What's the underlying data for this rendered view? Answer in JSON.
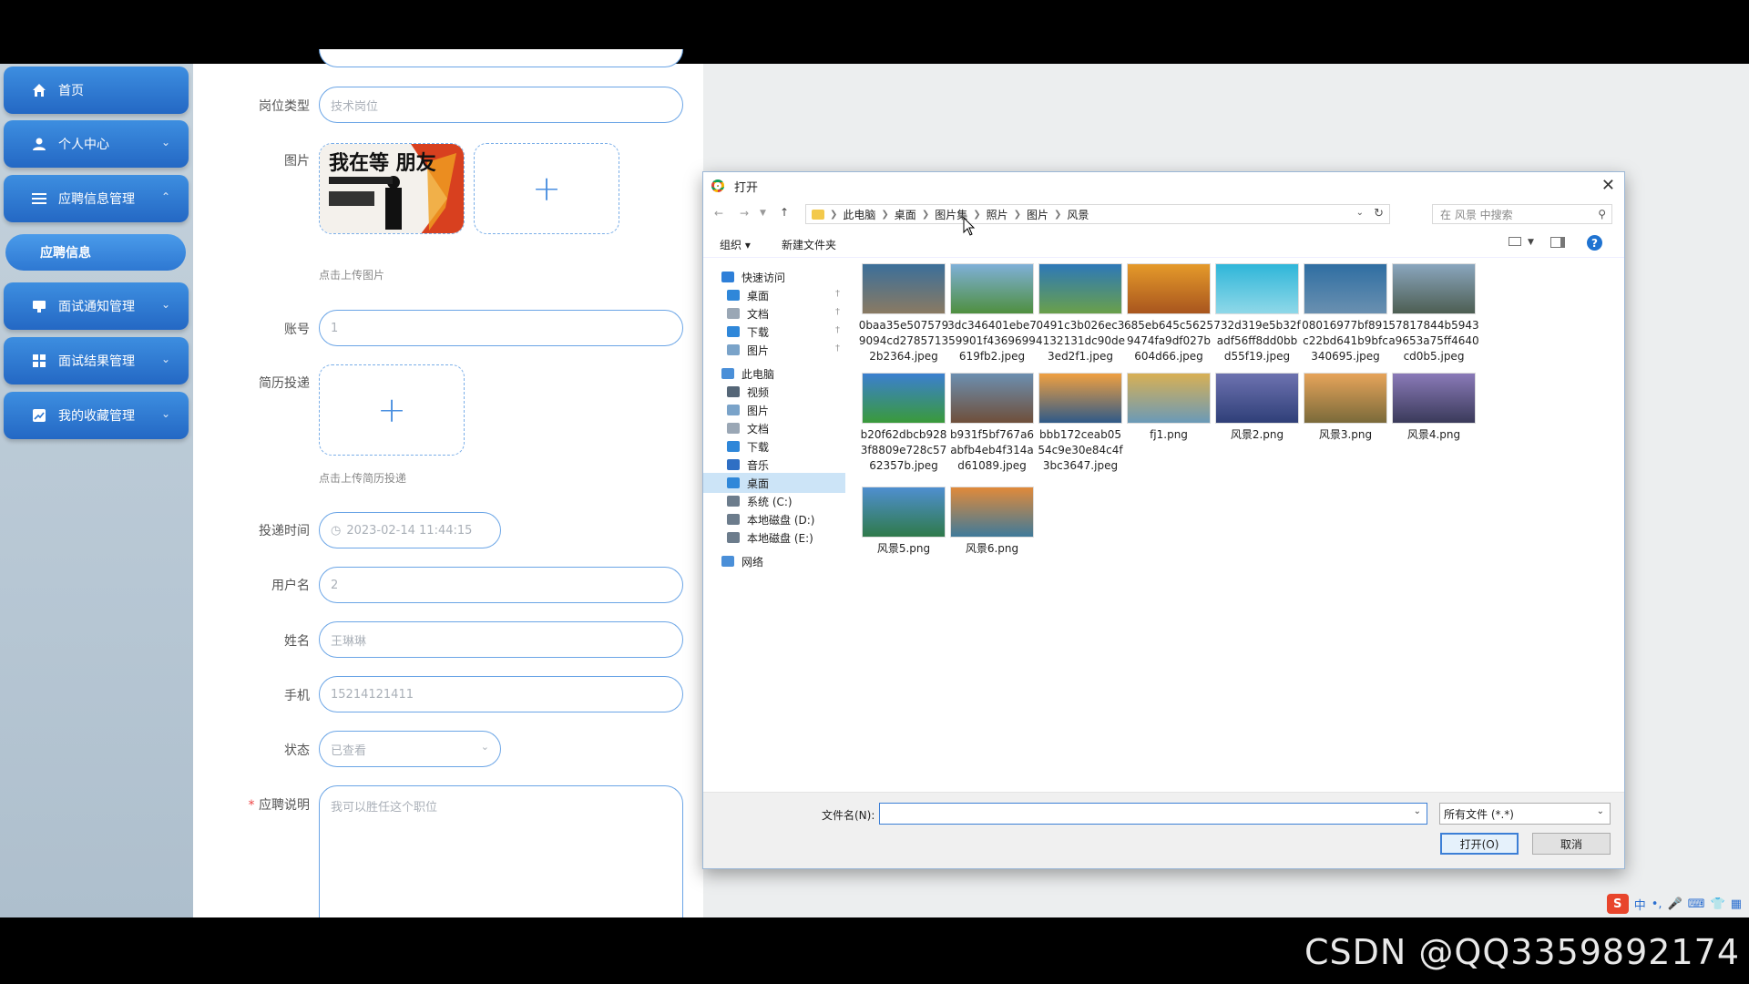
{
  "watermark": "CSDN @QQ3359892174",
  "sidebar": {
    "items": [
      {
        "label": "首页",
        "icon": "home-icon"
      },
      {
        "label": "个人中心",
        "icon": "user-icon"
      },
      {
        "label": "应聘信息管理",
        "icon": "list-icon"
      },
      {
        "label": "面试通知管理",
        "icon": "notice-icon"
      },
      {
        "label": "面试结果管理",
        "icon": "grid-icon"
      },
      {
        "label": "我的收藏管理",
        "icon": "chart-icon"
      }
    ],
    "submenu": {
      "label": "应聘信息"
    }
  },
  "form": {
    "job_type": {
      "label": "岗位类型",
      "placeholder": "技术岗位"
    },
    "image": {
      "label": "图片",
      "hint": "点击上传图片",
      "plus": "+",
      "thumb_text": "我在等 朋友"
    },
    "account": {
      "label": "账号",
      "value": "1"
    },
    "resume": {
      "label": "简历投递",
      "hint": "点击上传简历投递",
      "plus": "+"
    },
    "submit_time": {
      "label": "投递时间",
      "value": "2023-02-14 11:44:15"
    },
    "username": {
      "label": "用户名",
      "value": "2"
    },
    "name": {
      "label": "姓名",
      "value": "王琳琳"
    },
    "phone": {
      "label": "手机",
      "value": "15214121411"
    },
    "status": {
      "label": "状态",
      "value": "已查看"
    },
    "description": {
      "label": "应聘说明",
      "required_mark": "*",
      "placeholder": "我可以胜任这个职位"
    }
  },
  "dialog": {
    "title": "打开",
    "breadcrumbs": [
      "此电脑",
      "桌面",
      "图片集",
      "照片",
      "图片",
      "风景"
    ],
    "search_placeholder": "在 风景 中搜索",
    "toolbar": {
      "organize": "组织 ▾",
      "new_folder": "新建文件夹"
    },
    "nav": [
      {
        "label": "快速访问",
        "icon": "star-icon",
        "color": "#2e7fd8",
        "level": 0
      },
      {
        "label": "桌面",
        "icon": "desktop-icon",
        "color": "#2f87d9",
        "level": 1,
        "pinned": true
      },
      {
        "label": "文档",
        "icon": "document-icon",
        "color": "#9aa7b5",
        "level": 1,
        "pinned": true
      },
      {
        "label": "下载",
        "icon": "download-icon",
        "color": "#2f87d9",
        "level": 1,
        "pinned": true
      },
      {
        "label": "图片",
        "icon": "pictures-icon",
        "color": "#7aa3c9",
        "level": 1,
        "pinned": true
      },
      {
        "label": "此电脑",
        "icon": "computer-icon",
        "color": "#4a8fd8",
        "level": 0
      },
      {
        "label": "视频",
        "icon": "video-icon",
        "color": "#556677",
        "level": 1
      },
      {
        "label": "图片",
        "icon": "pictures-icon",
        "color": "#7aa3c9",
        "level": 1
      },
      {
        "label": "文档",
        "icon": "document-icon",
        "color": "#9aa7b5",
        "level": 1
      },
      {
        "label": "下载",
        "icon": "download-icon",
        "color": "#2f87d9",
        "level": 1
      },
      {
        "label": "音乐",
        "icon": "music-icon",
        "color": "#2f6fc4",
        "level": 1
      },
      {
        "label": "桌面",
        "icon": "desktop-icon",
        "color": "#2f87d9",
        "level": 1,
        "selected": true
      },
      {
        "label": "系统 (C:)",
        "icon": "drive-icon",
        "color": "#6c7c8c",
        "level": 1
      },
      {
        "label": "本地磁盘 (D:)",
        "icon": "drive-icon",
        "color": "#6c7c8c",
        "level": 1
      },
      {
        "label": "本地磁盘 (E:)",
        "icon": "drive-icon",
        "color": "#6c7c8c",
        "level": 1
      },
      {
        "label": "网络",
        "icon": "network-icon",
        "color": "#4a8fd8",
        "level": 0
      }
    ],
    "files": [
      {
        "name": "0baa35e507579 9094cd2785713 2b2364.jpeg",
        "colors": [
          "#3b6f9a",
          "#8a7a62"
        ]
      },
      {
        "name": "3dc346401ebe7 59901f4369699 619fb2.jpeg",
        "colors": [
          "#7fb0d8",
          "#4f8f3f"
        ]
      },
      {
        "name": "0491c3b026ec3 4132131dc90de 3ed2f1.jpeg",
        "colors": [
          "#2d78b8",
          "#6aa04a"
        ]
      },
      {
        "name": "685eb645c5625 9474fa9df027b 604d66.jpeg",
        "colors": [
          "#e59a2a",
          "#a8551e"
        ]
      },
      {
        "name": "732d319e5b32f adf56ff8dd0bb d55f19.jpeg",
        "colors": [
          "#2fb6d9",
          "#8fd8e8"
        ]
      },
      {
        "name": "08016977bf891 c22bd641b9bfc 340695.jpeg",
        "colors": [
          "#2f6ea2",
          "#6a90b0"
        ]
      },
      {
        "name": "57817844b5943 a9653a75ff4640 cd0b5.jpeg",
        "colors": [
          "#8aa6be",
          "#4d5e52"
        ]
      },
      {
        "name": "b20f62dbcb928 3f8809e728c57 62357b.jpeg",
        "colors": [
          "#3b7fd0",
          "#3a9a3a"
        ]
      },
      {
        "name": "b931f5bf767a6 abfb4eb4f314a d61089.jpeg",
        "colors": [
          "#6c8fb0",
          "#6f4f3a"
        ]
      },
      {
        "name": "bbb172ceab05 54c9e30e84c4f 3bc3647.jpeg",
        "colors": [
          "#f0a040",
          "#2f5a88"
        ]
      },
      {
        "name": "fj1.png",
        "colors": [
          "#d8b054",
          "#6a9ab8"
        ]
      },
      {
        "name": "风景2.png",
        "colors": [
          "#6d72b0",
          "#2f3f78"
        ]
      },
      {
        "name": "风景3.png",
        "colors": [
          "#e6a45a",
          "#7a6a3a"
        ]
      },
      {
        "name": "风景4.png",
        "colors": [
          "#8a7ab8",
          "#3a3a5a"
        ]
      },
      {
        "name": "风景5.png",
        "colors": [
          "#4f8fd0",
          "#2f7a4a"
        ]
      },
      {
        "name": "风景6.png",
        "colors": [
          "#e08a3a",
          "#3f7a9a"
        ]
      }
    ],
    "footer": {
      "filename_label": "文件名(N):",
      "filename_value": "",
      "filetype": "所有文件 (*.*)",
      "open_label": "打开(O)",
      "cancel_label": "取消"
    }
  },
  "tray": {
    "ime": "中"
  }
}
